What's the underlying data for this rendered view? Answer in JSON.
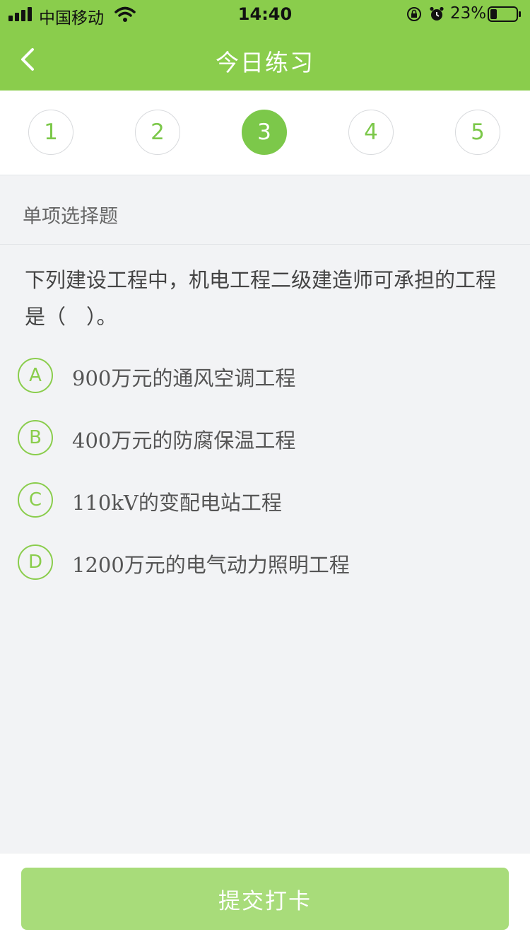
{
  "status": {
    "carrier": "中国移动",
    "time": "14:40",
    "battery": "23%"
  },
  "nav": {
    "title": "今日练习",
    "back_icon": "chevron-left-icon"
  },
  "steps": {
    "items": [
      "1",
      "2",
      "3",
      "4",
      "5"
    ],
    "active_index": 2
  },
  "question": {
    "type": "单项选择题",
    "text_line1": "下列建设工程中，机电工程二级建造师可承担的工程",
    "text_line2": "是（　）。",
    "options": [
      {
        "letter": "A",
        "text": "900万元的通风空调工程"
      },
      {
        "letter": "B",
        "text": "400万元的防腐保温工程"
      },
      {
        "letter": "C",
        "text": "110kV的变配电站工程"
      },
      {
        "letter": "D",
        "text": "1200万元的电气动力照明工程"
      }
    ]
  },
  "submit": {
    "label": "提交打卡"
  },
  "colors": {
    "brand_green": "#8acd4c",
    "active_step": "#7cc84a",
    "submit_disabled": "#a8dc7a"
  }
}
